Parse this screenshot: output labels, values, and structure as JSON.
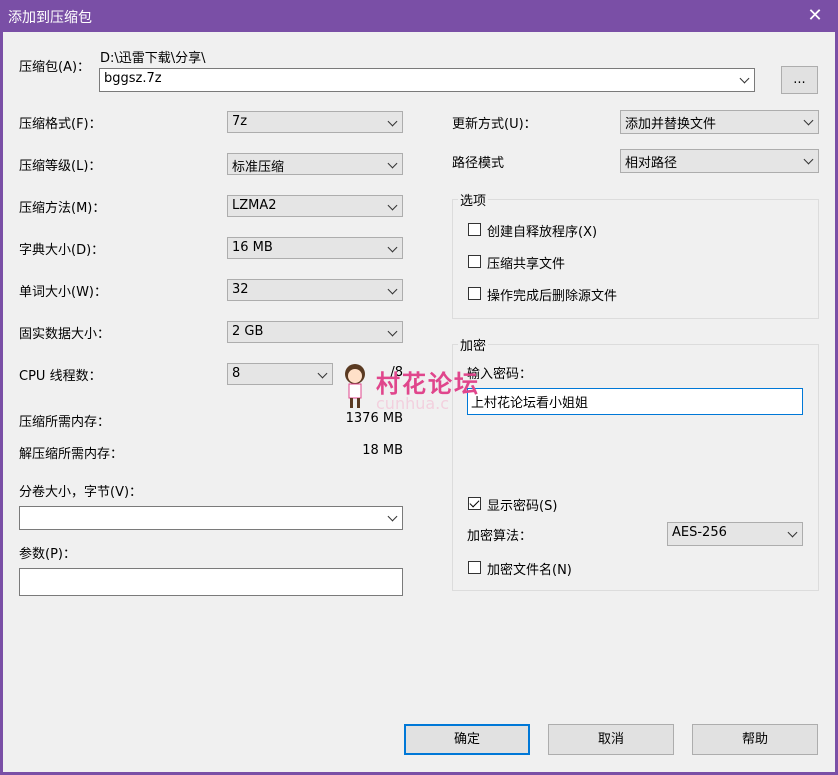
{
  "window": {
    "title": "添加到压缩包",
    "close_glyph": "✕"
  },
  "archive": {
    "label": "压缩包(A)：",
    "path": "D:\\迅雷下载\\分享\\",
    "filename": "bggsz.7z",
    "browse": "..."
  },
  "left": {
    "format_label": "压缩格式(F)：",
    "format_value": "7z",
    "level_label": "压缩等级(L)：",
    "level_value": "标准压缩",
    "method_label": "压缩方法(M)：",
    "method_value": "LZMA2",
    "dict_label": "字典大小(D)：",
    "dict_value": "16 MB",
    "word_label": "单词大小(W)：",
    "word_value": "32",
    "solid_label": "固实数据大小：",
    "solid_value": "2 GB",
    "threads_label": "CPU 线程数：",
    "threads_value": "8",
    "threads_total": "/8",
    "mem_compress_label": "压缩所需内存：",
    "mem_compress_value": "1376 MB",
    "mem_decompress_label": "解压缩所需内存：",
    "mem_decompress_value": "18 MB",
    "volume_label": "分卷大小，字节(V)：",
    "volume_value": "",
    "params_label": "参数(P)：",
    "params_value": ""
  },
  "right": {
    "update_label": "更新方式(U)：",
    "update_value": "添加并替换文件",
    "path_label": "路径模式",
    "path_value": "相对路径",
    "options_title": "选项",
    "opt_sfx": "创建自释放程序(X)",
    "opt_shared": "压缩共享文件",
    "opt_delete": "操作完成后删除源文件",
    "encrypt_title": "加密",
    "password_label": "输入密码：",
    "password_value": "上村花论坛看小姐姐",
    "show_password": "显示密码(S)",
    "algo_label": "加密算法：",
    "algo_value": "AES-256",
    "encrypt_names": "加密文件名(N)"
  },
  "buttons": {
    "ok": "确定",
    "cancel": "取消",
    "help": "帮助"
  },
  "watermark": {
    "text": "村花论坛",
    "sub": "cunhua.c"
  }
}
